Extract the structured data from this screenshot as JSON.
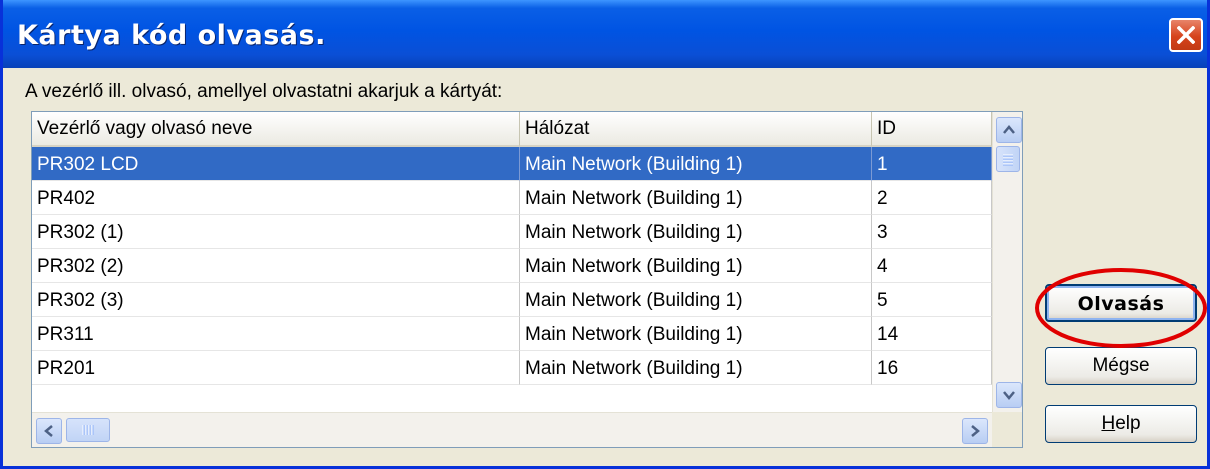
{
  "window": {
    "title": "Kártya kód olvasás."
  },
  "prompt": "A vezérlő ill. olvasó, amellyel olvastatni akarjuk a kártyát:",
  "table": {
    "columns": [
      "Vezérlő vagy olvasó neve",
      "Hálózat",
      "ID"
    ],
    "rows": [
      {
        "name": "PR302 LCD",
        "network": "Main Network (Building 1)",
        "id": "1",
        "selected": true
      },
      {
        "name": "PR402",
        "network": "Main Network (Building 1)",
        "id": "2"
      },
      {
        "name": "PR302 (1)",
        "network": "Main Network (Building 1)",
        "id": "3"
      },
      {
        "name": "PR302 (2)",
        "network": "Main Network (Building 1)",
        "id": "4"
      },
      {
        "name": "PR302 (3)",
        "network": "Main Network (Building 1)",
        "id": "5"
      },
      {
        "name": "PR311",
        "network": "Main Network (Building 1)",
        "id": "14"
      },
      {
        "name": "PR201",
        "network": "Main Network (Building 1)",
        "id": "16"
      }
    ]
  },
  "buttons": {
    "read": "Olvasás",
    "cancel": "Mégse",
    "help": "Help"
  },
  "icons": {
    "close": "close-icon",
    "scroll_up": "arrow-up-icon",
    "scroll_down": "arrow-down-icon",
    "scroll_left": "arrow-left-icon",
    "scroll_right": "arrow-right-icon"
  },
  "colors": {
    "title_bar": "#0054e3",
    "selection": "#316ac5",
    "annotation": "#e00000",
    "dialog_bg": "#ece9d8"
  }
}
